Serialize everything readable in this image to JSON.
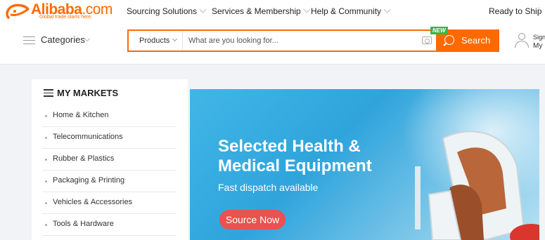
{
  "header": {
    "logo_text": "Alibaba",
    "logo_suffix": ".com",
    "logo_tagline": "Global trade starts here.",
    "nav": [
      {
        "label": "Sourcing Solutions"
      },
      {
        "label": "Services & Membership"
      },
      {
        "label": "Help & Community"
      }
    ],
    "ready_to_ship": "Ready to Ship"
  },
  "search": {
    "categories_label": "Categories",
    "scope_label": "Products",
    "placeholder": "What are you looking for...",
    "button_label": "Search",
    "new_badge": "NEW"
  },
  "account": {
    "sign_in": "Sign",
    "my": "My"
  },
  "markets": {
    "title": "MY MARKETS",
    "items": [
      {
        "label": "Home & Kitchen"
      },
      {
        "label": "Telecommunications"
      },
      {
        "label": "Rubber & Plastics"
      },
      {
        "label": "Packaging & Printing"
      },
      {
        "label": "Vehicles & Accessories"
      },
      {
        "label": "Tools & Hardware"
      }
    ]
  },
  "banner": {
    "title_line1": "Selected Health &",
    "title_line2": "Medical Equipment",
    "subtitle": "Fast dispatch available",
    "cta": "Source Now"
  },
  "colors": {
    "brand": "#ff6a00",
    "new_badge": "#3bb54a",
    "cta": "#e8524f",
    "banner": "#41b6e6"
  },
  "icons": [
    "alibaba-logo-icon",
    "chevron-down-icon",
    "menu-icon",
    "camera-icon",
    "search-icon",
    "user-icon",
    "massage-chair-image"
  ]
}
